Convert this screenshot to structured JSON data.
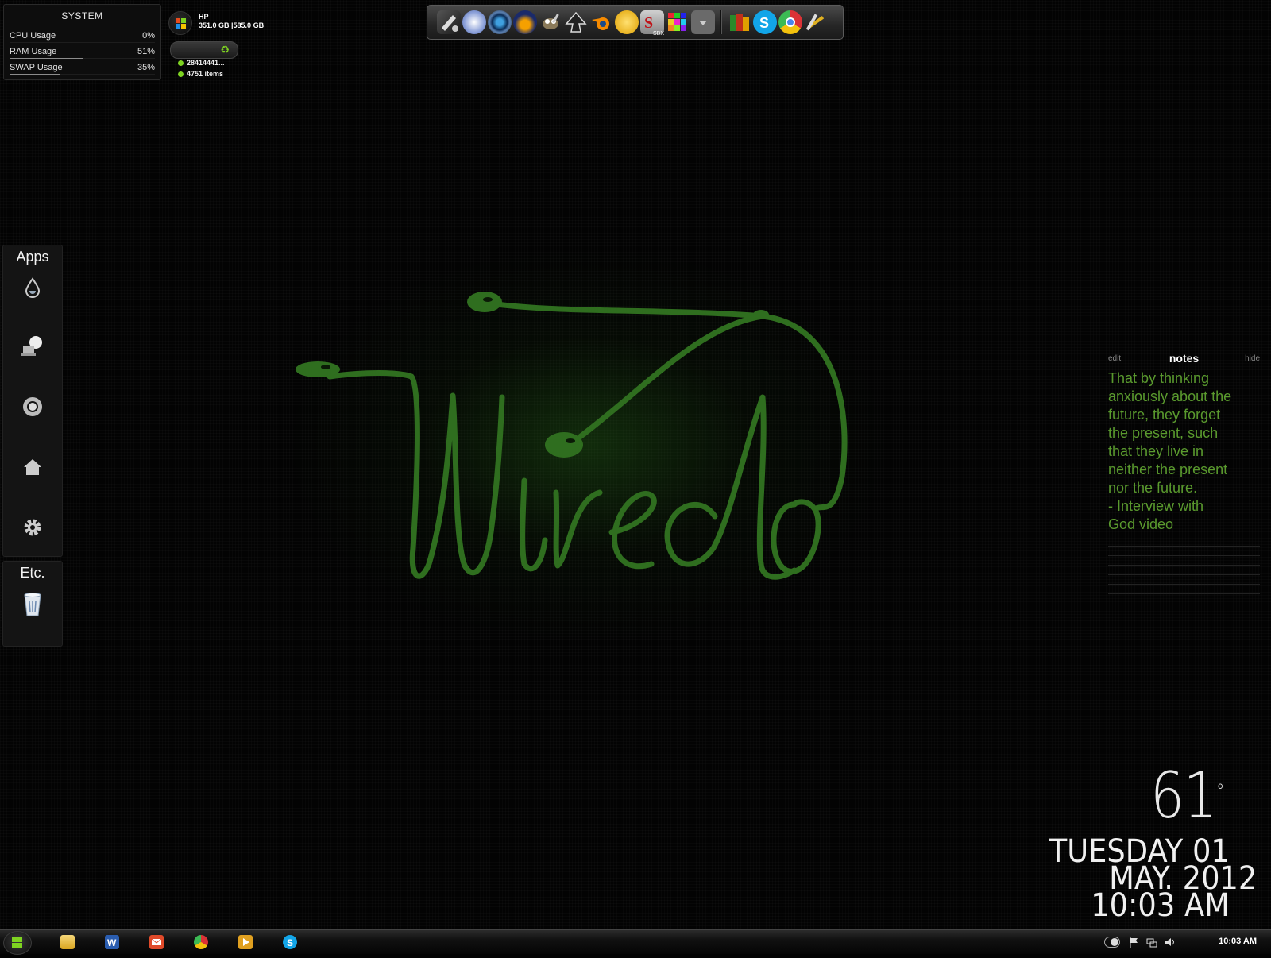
{
  "system_monitor": {
    "title": "SYSTEM",
    "rows": [
      {
        "label": "CPU Usage",
        "value": "0%",
        "level": 0
      },
      {
        "label": "RAM Usage",
        "value": "51%",
        "level": 51
      },
      {
        "label": "SWAP Usage",
        "value": "35%",
        "level": 35
      }
    ]
  },
  "drive": {
    "name": "HP",
    "size": "351.0 GB |585.0 GB"
  },
  "recycle": {
    "items": [
      "28414441...",
      "4751 items"
    ]
  },
  "dock": {
    "icons": [
      "pen-tool-icon",
      "media-player-icon",
      "camera-lens-icon",
      "flame-app-icon",
      "gimp-icon",
      "inkscape-icon",
      "blender-icon",
      "fl-studio-icon",
      "sbx-app-icon",
      "palette-grid-icon",
      "dropdown-icon",
      "office-icon",
      "skype-icon",
      "chrome-icon",
      "tools-icon"
    ],
    "sbx_label": "SBX"
  },
  "apps_launcher": {
    "title": "Apps",
    "icons": [
      "water-drop-icon",
      "computer-icon",
      "chrome-icon",
      "home-icon",
      "gear-icon"
    ]
  },
  "etc_launcher": {
    "title": "Etc.",
    "icons": [
      "recycle-bin-icon"
    ]
  },
  "notes": {
    "edit": "edit",
    "title": "notes",
    "hide": "hide",
    "lines": [
      "That by thinking",
      "anxiously about the",
      "future, they forget",
      "the present, such",
      "that they live in",
      "neither the present",
      "nor the future.",
      "- Interview with",
      "God video"
    ]
  },
  "weather": {
    "temperature": "61",
    "degree": "°"
  },
  "date": {
    "weekday": "TUESDAY",
    "day": "01",
    "month_year": "MAY. 2012",
    "time": "10:03 AM"
  },
  "taskbar": {
    "apps": [
      "file-explorer-icon",
      "word-icon",
      "mail-icon",
      "chrome-icon",
      "media-player-icon",
      "skype-icon"
    ],
    "tray_icons": [
      "toggle-icon",
      "flag-icon",
      "network-icon",
      "volume-icon"
    ],
    "clock": "10:03 AM"
  },
  "colors": {
    "accent_green": "#5a9a2e",
    "logo_green": "#2f6e1f",
    "status_green": "#7ed321"
  }
}
